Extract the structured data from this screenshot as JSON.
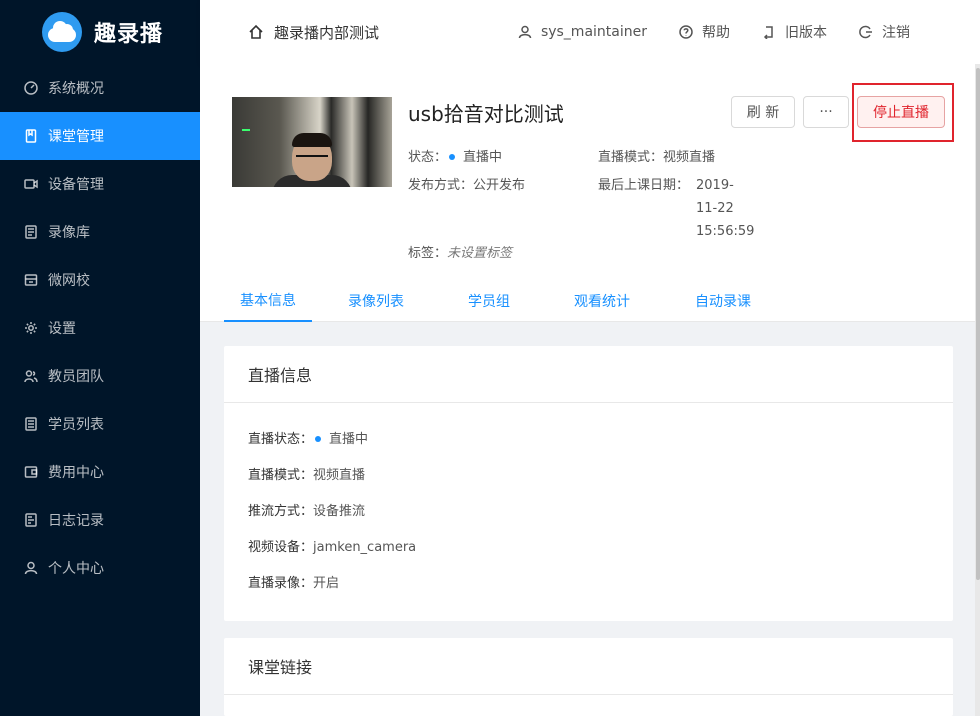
{
  "app": {
    "name": "趣录播"
  },
  "sidebar": {
    "items": [
      {
        "label": "系统概况",
        "icon": "dashboard-icon"
      },
      {
        "label": "课堂管理",
        "icon": "book-icon",
        "active": true
      },
      {
        "label": "设备管理",
        "icon": "camera-icon"
      },
      {
        "label": "录像库",
        "icon": "archive-icon"
      },
      {
        "label": "微网校",
        "icon": "school-icon"
      },
      {
        "label": "设置",
        "icon": "gear-icon"
      },
      {
        "label": "教员团队",
        "icon": "team-icon"
      },
      {
        "label": "学员列表",
        "icon": "list-icon"
      },
      {
        "label": "费用中心",
        "icon": "wallet-icon"
      },
      {
        "label": "日志记录",
        "icon": "log-icon"
      },
      {
        "label": "个人中心",
        "icon": "user-icon"
      }
    ]
  },
  "header": {
    "org": "趣录播内部测试",
    "user": "sys_maintainer",
    "help": "帮助",
    "old_version": "旧版本",
    "logout": "注销"
  },
  "course": {
    "title": "usb拾音对比测试",
    "status_label": "状态：",
    "status_value": "直播中",
    "mode_label": "直播模式：",
    "mode_value": "视频直播",
    "publish_label": "发布方式：",
    "publish_value": "公开发布",
    "last_date_label": "最后上课日期：",
    "last_date_line1": "2019-",
    "last_date_line2": "11-22",
    "last_date_line3": "15:56:59",
    "tags_label": "标签：",
    "tags_value": "未设置标签"
  },
  "actions": {
    "refresh": "刷 新",
    "more": "···",
    "stop": "停止直播"
  },
  "tabs": [
    {
      "label": "基本信息",
      "active": true
    },
    {
      "label": "录像列表"
    },
    {
      "label": "学员组"
    },
    {
      "label": "观看统计"
    },
    {
      "label": "自动录课"
    }
  ],
  "live_info": {
    "title": "直播信息",
    "rows": [
      {
        "k": "直播状态：",
        "v": "直播中",
        "dot": true
      },
      {
        "k": "直播模式：",
        "v": "视频直播"
      },
      {
        "k": "推流方式：",
        "v": "设备推流"
      },
      {
        "k": "视频设备：",
        "v": "jamken_camera"
      },
      {
        "k": "直播录像：",
        "v": "开启"
      }
    ]
  },
  "links_card": {
    "title": "课堂链接"
  },
  "colors": {
    "sidebar_bg": "#001529",
    "accent": "#1890ff",
    "danger": "#e0242d"
  }
}
